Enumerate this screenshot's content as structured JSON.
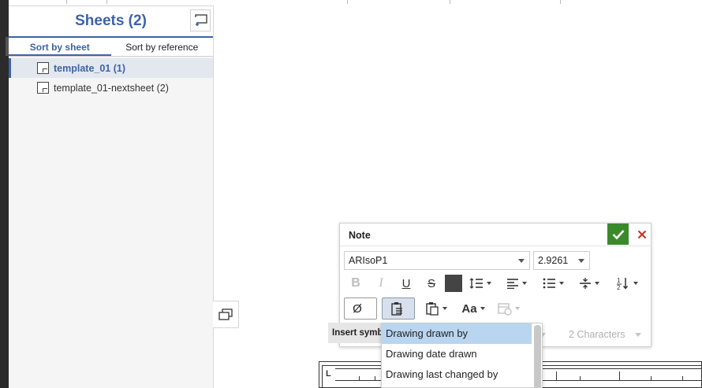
{
  "sheets_panel": {
    "title": "Sheets (2)",
    "tabs": [
      {
        "label": "Sort by sheet",
        "active": true
      },
      {
        "label": "Sort by reference",
        "active": false
      }
    ],
    "sheets": [
      {
        "label": "template_01 (1)",
        "selected": true
      },
      {
        "label": "template_01-nextsheet (2)",
        "selected": false
      }
    ]
  },
  "note_dialog": {
    "title": "Note",
    "font": "ARIsoP1",
    "size": "2.9261",
    "characters": "2 Characters",
    "toolbar_row1": [
      "bold-icon",
      "italic-icon",
      "underline-icon",
      "strikethrough-icon",
      "color-swatch",
      "line-spacing-icon",
      "align-icon",
      "list-icon",
      "vertical-align-icon",
      "stack-fraction-icon"
    ],
    "toolbar_row2": [
      "diameter-symbol-button",
      "insert-property-button",
      "paste-icon",
      "text-case-icon",
      "date-icon"
    ],
    "phi_label": "Ø",
    "underline_label": "U",
    "strike_label": "S",
    "bold_label": "B",
    "italic_label": "I",
    "case_label": "Aa"
  },
  "tooltip": {
    "text": "Insert symbol"
  },
  "dropdown": {
    "items": [
      {
        "label": "Drawing drawn by",
        "highlighted": true
      },
      {
        "label": "Drawing date drawn",
        "highlighted": false
      },
      {
        "label": "Drawing last changed by",
        "highlighted": false
      }
    ]
  },
  "title_block": {
    "label": "L"
  },
  "colors": {
    "accent": "#3d63a6",
    "ok_green": "#3a8a2c",
    "cancel_red": "#c0392b",
    "highlight": "#b9d5f0"
  }
}
